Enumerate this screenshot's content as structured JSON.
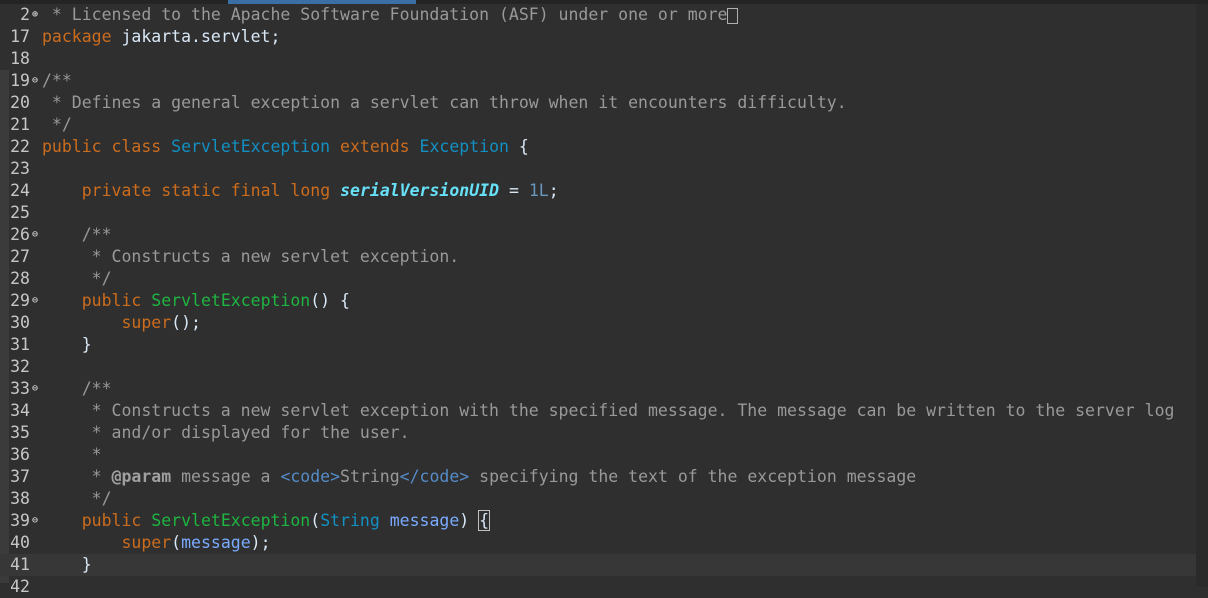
{
  "editor": {
    "lines": [
      {
        "num": "2",
        "fold": "plus",
        "tokens": [
          {
            "t": " * Licensed to the Apache Software Foundation (ASF) under one or more",
            "c": "cm"
          }
        ],
        "collapsed": true
      },
      {
        "num": "17",
        "tokens": [
          {
            "t": "package",
            "c": "kw"
          },
          {
            "t": " jakarta.servlet;",
            "c": "pl"
          }
        ]
      },
      {
        "num": "18",
        "tokens": []
      },
      {
        "num": "19",
        "fold": "minus",
        "tokens": [
          {
            "t": "/**",
            "c": "cm"
          }
        ]
      },
      {
        "num": "20",
        "tokens": [
          {
            "t": " * Defines a general exception a servlet can throw when it encounters difficulty.",
            "c": "cm"
          }
        ]
      },
      {
        "num": "21",
        "tokens": [
          {
            "t": " */",
            "c": "cm"
          }
        ]
      },
      {
        "num": "22",
        "tokens": [
          {
            "t": "public",
            "c": "kw"
          },
          {
            "t": " ",
            "c": "pl"
          },
          {
            "t": "class",
            "c": "kw"
          },
          {
            "t": " ",
            "c": "pl"
          },
          {
            "t": "ServletException",
            "c": "ty"
          },
          {
            "t": " ",
            "c": "pl"
          },
          {
            "t": "extends",
            "c": "kw"
          },
          {
            "t": " ",
            "c": "pl"
          },
          {
            "t": "Exception",
            "c": "ty"
          },
          {
            "t": " {",
            "c": "pl"
          }
        ]
      },
      {
        "num": "23",
        "tokens": []
      },
      {
        "num": "24",
        "tokens": [
          {
            "t": "    ",
            "c": "pl"
          },
          {
            "t": "private",
            "c": "kw"
          },
          {
            "t": " ",
            "c": "pl"
          },
          {
            "t": "static",
            "c": "kw"
          },
          {
            "t": " ",
            "c": "pl"
          },
          {
            "t": "final",
            "c": "kw"
          },
          {
            "t": " ",
            "c": "pl"
          },
          {
            "t": "long",
            "c": "kw"
          },
          {
            "t": " ",
            "c": "pl"
          },
          {
            "t": "serialVersionUID",
            "c": "fld"
          },
          {
            "t": " = ",
            "c": "pl"
          },
          {
            "t": "1L",
            "c": "num-lit"
          },
          {
            "t": ";",
            "c": "pl"
          }
        ]
      },
      {
        "num": "25",
        "tokens": []
      },
      {
        "num": "26",
        "fold": "minus",
        "tokens": [
          {
            "t": "    ",
            "c": "pl"
          },
          {
            "t": "/**",
            "c": "cm"
          }
        ]
      },
      {
        "num": "27",
        "tokens": [
          {
            "t": "     * Constructs a new servlet exception.",
            "c": "cm"
          }
        ]
      },
      {
        "num": "28",
        "tokens": [
          {
            "t": "     */",
            "c": "cm"
          }
        ]
      },
      {
        "num": "29",
        "fold": "minus",
        "tokens": [
          {
            "t": "    ",
            "c": "pl"
          },
          {
            "t": "public",
            "c": "kw"
          },
          {
            "t": " ",
            "c": "pl"
          },
          {
            "t": "ServletException",
            "c": "ctor"
          },
          {
            "t": "() {",
            "c": "pl"
          }
        ]
      },
      {
        "num": "30",
        "tokens": [
          {
            "t": "        ",
            "c": "pl"
          },
          {
            "t": "super",
            "c": "kw"
          },
          {
            "t": "();",
            "c": "pl"
          }
        ]
      },
      {
        "num": "31",
        "tokens": [
          {
            "t": "    }",
            "c": "pl"
          }
        ]
      },
      {
        "num": "32",
        "tokens": []
      },
      {
        "num": "33",
        "fold": "minus",
        "tokens": [
          {
            "t": "    ",
            "c": "pl"
          },
          {
            "t": "/**",
            "c": "cm"
          }
        ]
      },
      {
        "num": "34",
        "tokens": [
          {
            "t": "     * Constructs a new servlet exception with the specified message. The message can be written to the server log",
            "c": "cm"
          }
        ]
      },
      {
        "num": "35",
        "tokens": [
          {
            "t": "     * and/or displayed for the user.",
            "c": "cm"
          }
        ]
      },
      {
        "num": "36",
        "tokens": [
          {
            "t": "     *",
            "c": "cm"
          }
        ]
      },
      {
        "num": "37",
        "tokens": [
          {
            "t": "     * ",
            "c": "cm"
          },
          {
            "t": "@param",
            "c": "doctag"
          },
          {
            "t": " message a ",
            "c": "cm"
          },
          {
            "t": "<code>",
            "c": "tag"
          },
          {
            "t": "String",
            "c": "cm"
          },
          {
            "t": "</code>",
            "c": "tag"
          },
          {
            "t": " specifying the text of the exception message",
            "c": "cm"
          }
        ]
      },
      {
        "num": "38",
        "tokens": [
          {
            "t": "     */",
            "c": "cm"
          }
        ]
      },
      {
        "num": "39",
        "fold": "minus",
        "tokens": [
          {
            "t": "    ",
            "c": "pl"
          },
          {
            "t": "public",
            "c": "kw"
          },
          {
            "t": " ",
            "c": "pl"
          },
          {
            "t": "ServletException",
            "c": "ctor"
          },
          {
            "t": "(",
            "c": "pl"
          },
          {
            "t": "String",
            "c": "ty"
          },
          {
            "t": " ",
            "c": "pl"
          },
          {
            "t": "message",
            "c": "var"
          },
          {
            "t": ") ",
            "c": "pl"
          },
          {
            "t": "{",
            "c": "bracehl"
          }
        ]
      },
      {
        "num": "40",
        "tokens": [
          {
            "t": "        ",
            "c": "pl"
          },
          {
            "t": "super",
            "c": "kw"
          },
          {
            "t": "(",
            "c": "pl"
          },
          {
            "t": "message",
            "c": "var"
          },
          {
            "t": ");",
            "c": "pl"
          }
        ]
      },
      {
        "num": "41",
        "current": true,
        "tokens": [
          {
            "t": "    }",
            "c": "pl"
          }
        ]
      },
      {
        "num": "42",
        "tokens": []
      }
    ]
  }
}
